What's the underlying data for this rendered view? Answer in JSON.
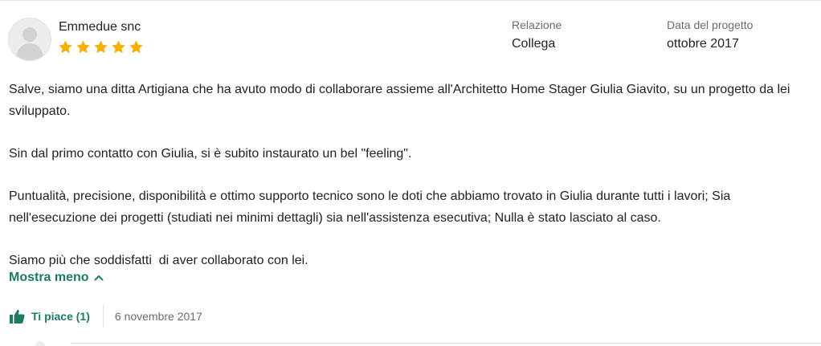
{
  "review": {
    "reviewer_name": "Emmedue snc",
    "rating": 5,
    "rating_max": 5,
    "relation_label": "Relazione",
    "relation_value": "Collega",
    "project_date_label": "Data del progetto",
    "project_date_value": "ottobre 2017",
    "paragraphs": [
      "Salve, siamo una ditta Artigiana che ha avuto modo di collaborare assieme all'Architetto Home Stager Giulia Giavito, su un progetto da lei sviluppato.",
      "Sin dal primo contatto con Giulia, si è subito instaurato un bel \"feeling\".",
      "Puntualità, precisione, disponibilità e ottimo supporto tecnico sono le doti che abbiamo trovato in Giulia durante tutti i lavori; Sia nell'esecuzione dei progetti (studiati nei minimi dettagli) sia nell'assistenza esecutiva; Nulla è stato lasciato al caso.",
      "Siamo più che soddisfatti  di aver collaborato con lei."
    ],
    "show_less_label": "Mostra meno",
    "like_label": "Ti piace (1)",
    "posted_date": "6 novembre 2017"
  },
  "colors": {
    "accent": "#1e7a63",
    "star": "#f6b000",
    "muted_text": "#6b6b6b"
  },
  "icons": {
    "avatar": "default-user-avatar-icon",
    "star": "star-icon",
    "show_less": "chevron-up-icon",
    "like": "thumbs-up-icon"
  }
}
